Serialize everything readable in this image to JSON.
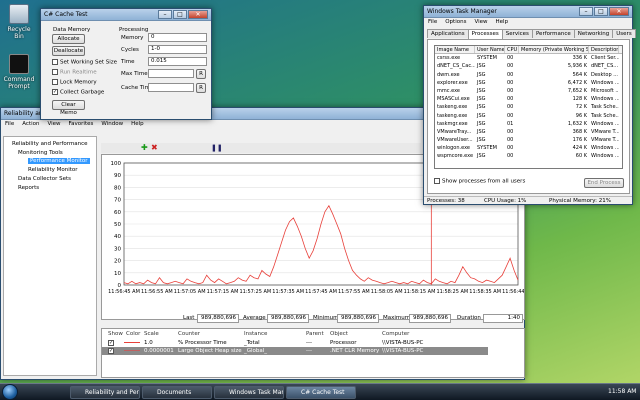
{
  "desktop": {
    "recycle_bin": "Recycle Bin",
    "command_prompt": "Command Prompt"
  },
  "cache_test": {
    "title": "C# Cache Test",
    "data_memory_label": "Data Memory",
    "allocate": "Allocate",
    "deallocate": "Deallocate",
    "set_working_set": "Set Working Set Size",
    "run_realtime": "Run Realtime",
    "lock_memory": "Lock Memory",
    "collect_garbage": "Collect Garbage",
    "clear_memo": "Clear Memo",
    "processing_label": "Processing",
    "memory_label": "Memory",
    "memory_value": "0",
    "cycles_label": "Cycles",
    "cycles_value": "1-0",
    "time_label": "Time",
    "time_value": "0.015",
    "max_time_label": "Max Time",
    "max_time_value": "",
    "cache_time_label": "Cache Time",
    "cache_time_value": "",
    "r_btn": "R",
    "collect_checked": true
  },
  "task_manager": {
    "title": "Windows Task Manager",
    "menu": [
      "File",
      "Options",
      "View",
      "Help"
    ],
    "tabs": [
      "Applications",
      "Processes",
      "Services",
      "Performance",
      "Networking",
      "Users"
    ],
    "active_tab": 1,
    "columns": [
      "Image Name",
      "User Name",
      "CPU",
      "Memory (Private Working Set)",
      "Description"
    ],
    "rows": [
      [
        "csrss.exe",
        "SYSTEM",
        "00",
        "336 K",
        "Client Ser..."
      ],
      [
        "dNET_CS_Cac...",
        "JSG",
        "00",
        "5,936 K",
        "dNET_CS..."
      ],
      [
        "dwm.exe",
        "JSG",
        "00",
        "564 K",
        "Desktop ..."
      ],
      [
        "explorer.exe",
        "JSG",
        "00",
        "6,472 K",
        "Windows ..."
      ],
      [
        "mmc.exe",
        "JSG",
        "00",
        "7,652 K",
        "Microsoft ..."
      ],
      [
        "MSASCui.exe",
        "JSG",
        "00",
        "128 K",
        "Windows ..."
      ],
      [
        "taskeng.exe",
        "JSG",
        "00",
        "72 K",
        "Task Sche..."
      ],
      [
        "taskeng.exe",
        "JSG",
        "00",
        "96 K",
        "Task Sche..."
      ],
      [
        "taskmgr.exe",
        "JSG",
        "01",
        "1,632 K",
        "Windows ..."
      ],
      [
        "VMwareTray...",
        "JSG",
        "00",
        "368 K",
        "VMware T..."
      ],
      [
        "VMwareUser...",
        "JSG",
        "00",
        "176 K",
        "VMware T..."
      ],
      [
        "winlogon.exe",
        "SYSTEM",
        "00",
        "424 K",
        "Windows ..."
      ],
      [
        "wspmcore.exe",
        "JSG",
        "00",
        "60 K",
        "Windows ..."
      ]
    ],
    "show_all": "Show processes from all users",
    "end_process": "End Process",
    "status_processes": "Processes: 38",
    "status_cpu": "CPU Usage: 1%",
    "status_memory": "Physical Memory: 21%"
  },
  "perfmon": {
    "title": "Reliability and Performance Monitor",
    "menu": [
      "File",
      "Action",
      "View",
      "Favorites",
      "Window",
      "Help"
    ],
    "tree": [
      "Reliability and Performance",
      "Monitoring Tools",
      "Performance Monitor",
      "Reliability Monitor",
      "Data Collector Sets",
      "Reports"
    ],
    "y_ticks": [
      "100",
      "90",
      "80",
      "70",
      "60",
      "50",
      "40",
      "30",
      "20",
      "10",
      "0"
    ],
    "x_ticks": [
      "11:56:45 AM",
      "11:56:55 AM",
      "11:57:05 AM",
      "11:57:15 AM",
      "11:57:25 AM",
      "11:57:35 AM",
      "11:57:45 AM",
      "11:57:55 AM",
      "11:58:05 AM",
      "11:58:15 AM",
      "11:58:25 AM",
      "11:58:35 AM",
      "11:56:44 AM"
    ],
    "stats": {
      "last_label": "Last",
      "last": "989,880,696",
      "average_label": "Average",
      "average": "989,880,696",
      "minimum_label": "Minimum",
      "minimum": "989,880,696",
      "maximum_label": "Maximum",
      "maximum": "989,880,696",
      "duration_label": "Duration",
      "duration": "1:40"
    },
    "legend_headers": [
      "Show",
      "Color",
      "Scale",
      "Counter",
      "Instance",
      "Parent",
      "Object",
      "Computer"
    ],
    "legend_rows": [
      [
        "1.0",
        "% Processor Time",
        "_Total",
        "---",
        "Processor",
        "\\\\VISTA-BUS-PC"
      ],
      [
        "0.0000001",
        "Large Object Heap size",
        "_Global_",
        "---",
        ".NET CLR Memory",
        "\\\\VISTA-BUS-PC"
      ]
    ],
    "colors": {
      "cpu": "#e8403a",
      "heap": "#c06060"
    }
  },
  "chart_data": {
    "type": "line",
    "ylim": [
      0,
      100
    ],
    "series": [
      {
        "values": [
          2,
          1,
          3,
          1,
          2,
          1,
          4,
          2,
          1,
          6,
          2,
          1,
          2,
          3,
          2,
          1,
          5,
          3,
          2,
          1,
          2,
          8,
          4,
          2,
          5,
          3,
          1,
          2,
          3,
          6,
          4,
          3,
          8,
          6,
          5,
          12,
          9,
          7,
          15,
          25,
          35,
          45,
          52,
          55,
          48,
          40,
          30,
          22,
          28,
          38,
          50,
          60,
          65,
          58,
          50,
          42,
          30,
          20,
          12,
          8,
          5,
          3,
          6,
          4,
          3,
          2,
          1,
          2,
          3,
          2,
          1,
          2,
          1,
          3,
          2,
          1,
          4,
          2,
          1,
          5,
          3,
          2,
          1,
          3,
          2,
          8,
          15,
          10,
          6,
          5,
          3,
          2,
          4,
          3,
          2,
          5,
          8,
          15,
          22,
          12,
          4
        ]
      }
    ]
  },
  "taskbar": {
    "buttons": [
      "Reliability and Perfo...",
      "Documents",
      "Windows Task Man...",
      "C# Cache Test"
    ],
    "clock": "11:58 AM"
  }
}
